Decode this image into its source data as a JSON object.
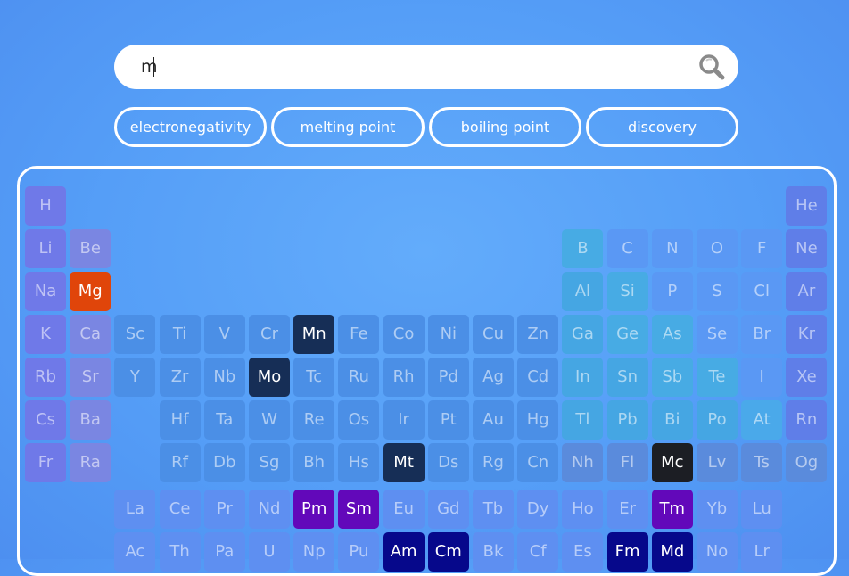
{
  "search": {
    "query": "m",
    "icon": "search-icon"
  },
  "filters": [
    {
      "label": "electronegativity"
    },
    {
      "label": "melting point"
    },
    {
      "label": "boiling point"
    },
    {
      "label": "discovery"
    }
  ],
  "colors": {
    "alkali": "#6f79e8",
    "alkaline": "#7a86e2",
    "transition": "#4b8fe6",
    "posttransition": "#45a6e3",
    "metalloid": "#47abe4",
    "nonmetal": "#5a98f4",
    "halogen": "#4aa9ea",
    "noble": "#5f7ee8",
    "lanth": "#5e8ff1",
    "actin": "#5e8ff1",
    "unknown": "#5a8bdc",
    "hl_orange": "#e0450a",
    "hl_navy": "#162e56",
    "hl_purple": "#6208ba",
    "hl_darkblue": "#06088b",
    "hl_black": "#1c1e24"
  },
  "elements": [
    {
      "s": "H"
    },
    {
      "s": "He"
    },
    {
      "s": "Li"
    },
    {
      "s": "Be"
    },
    {
      "s": "B"
    },
    {
      "s": "C"
    },
    {
      "s": "N"
    },
    {
      "s": "O"
    },
    {
      "s": "F"
    },
    {
      "s": "Ne"
    },
    {
      "s": "Na"
    },
    {
      "s": "Mg"
    },
    {
      "s": "Al"
    },
    {
      "s": "Si"
    },
    {
      "s": "P"
    },
    {
      "s": "S"
    },
    {
      "s": "Cl"
    },
    {
      "s": "Ar"
    },
    {
      "s": "K"
    },
    {
      "s": "Ca"
    },
    {
      "s": "Sc"
    },
    {
      "s": "Ti"
    },
    {
      "s": "V"
    },
    {
      "s": "Cr"
    },
    {
      "s": "Mn"
    },
    {
      "s": "Fe"
    },
    {
      "s": "Co"
    },
    {
      "s": "Ni"
    },
    {
      "s": "Cu"
    },
    {
      "s": "Zn"
    },
    {
      "s": "Ga"
    },
    {
      "s": "Ge"
    },
    {
      "s": "As"
    },
    {
      "s": "Se"
    },
    {
      "s": "Br"
    },
    {
      "s": "Kr"
    },
    {
      "s": "Rb"
    },
    {
      "s": "Sr"
    },
    {
      "s": "Y"
    },
    {
      "s": "Zr"
    },
    {
      "s": "Nb"
    },
    {
      "s": "Mo"
    },
    {
      "s": "Tc"
    },
    {
      "s": "Ru"
    },
    {
      "s": "Rh"
    },
    {
      "s": "Pd"
    },
    {
      "s": "Ag"
    },
    {
      "s": "Cd"
    },
    {
      "s": "In"
    },
    {
      "s": "Sn"
    },
    {
      "s": "Sb"
    },
    {
      "s": "Te"
    },
    {
      "s": "I"
    },
    {
      "s": "Xe"
    },
    {
      "s": "Cs"
    },
    {
      "s": "Ba"
    },
    {
      "s": "Hf"
    },
    {
      "s": "Ta"
    },
    {
      "s": "W"
    },
    {
      "s": "Re"
    },
    {
      "s": "Os"
    },
    {
      "s": "Ir"
    },
    {
      "s": "Pt"
    },
    {
      "s": "Au"
    },
    {
      "s": "Hg"
    },
    {
      "s": "Tl"
    },
    {
      "s": "Pb"
    },
    {
      "s": "Bi"
    },
    {
      "s": "Po"
    },
    {
      "s": "At"
    },
    {
      "s": "Rn"
    },
    {
      "s": "Fr"
    },
    {
      "s": "Ra"
    },
    {
      "s": "Rf"
    },
    {
      "s": "Db"
    },
    {
      "s": "Sg"
    },
    {
      "s": "Bh"
    },
    {
      "s": "Hs"
    },
    {
      "s": "Mt"
    },
    {
      "s": "Ds"
    },
    {
      "s": "Rg"
    },
    {
      "s": "Cn"
    },
    {
      "s": "Nh"
    },
    {
      "s": "Fl"
    },
    {
      "s": "Mc"
    },
    {
      "s": "Lv"
    },
    {
      "s": "Ts"
    },
    {
      "s": "Og"
    },
    {
      "s": "La"
    },
    {
      "s": "Ce"
    },
    {
      "s": "Pr"
    },
    {
      "s": "Nd"
    },
    {
      "s": "Pm"
    },
    {
      "s": "Sm"
    },
    {
      "s": "Eu"
    },
    {
      "s": "Gd"
    },
    {
      "s": "Tb"
    },
    {
      "s": "Dy"
    },
    {
      "s": "Ho"
    },
    {
      "s": "Er"
    },
    {
      "s": "Tm"
    },
    {
      "s": "Yb"
    },
    {
      "s": "Lu"
    },
    {
      "s": "Ac"
    },
    {
      "s": "Th"
    },
    {
      "s": "Pa"
    },
    {
      "s": "U"
    },
    {
      "s": "Np"
    },
    {
      "s": "Pu"
    },
    {
      "s": "Am"
    },
    {
      "s": "Cm"
    },
    {
      "s": "Bk"
    },
    {
      "s": "Cf"
    },
    {
      "s": "Es"
    },
    {
      "s": "Fm"
    },
    {
      "s": "Md"
    },
    {
      "s": "No"
    },
    {
      "s": "Lr"
    }
  ]
}
